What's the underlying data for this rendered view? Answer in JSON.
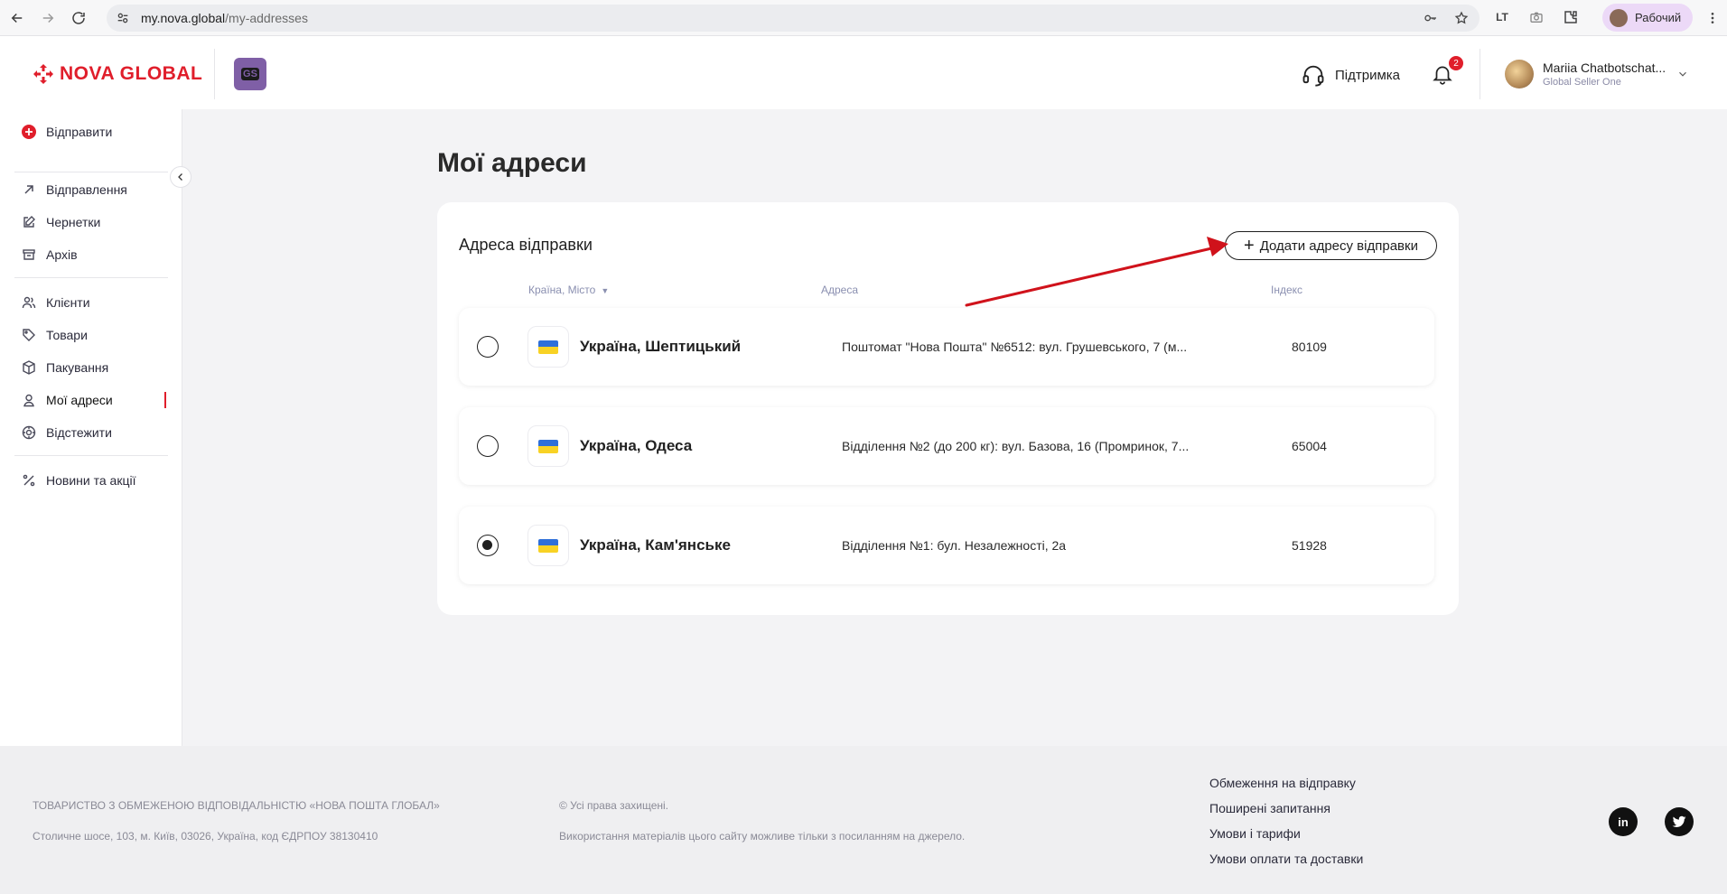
{
  "browser": {
    "url_host": "my.nova.global",
    "url_path": "/my-addresses",
    "profile_label": "Рабочий"
  },
  "header": {
    "logo_text": "NOVA GLOBAL",
    "gs_badge": "GS",
    "support_label": "Підтримка",
    "notifications_count": "2",
    "user_name": "Mariia Chatbotschat...",
    "user_org": "Global Seller One"
  },
  "sidebar": {
    "send_label": "Відправити",
    "items": [
      {
        "label": "Відправлення",
        "icon": "arrow-up-right-icon"
      },
      {
        "label": "Чернетки",
        "icon": "edit-icon"
      },
      {
        "label": "Архів",
        "icon": "archive-icon"
      },
      {
        "label": "Клієнти",
        "icon": "users-icon"
      },
      {
        "label": "Товари",
        "icon": "tag-icon"
      },
      {
        "label": "Пакування",
        "icon": "box-icon"
      },
      {
        "label": "Мої адреси",
        "icon": "location-user-icon",
        "active": true
      },
      {
        "label": "Відстежити",
        "icon": "target-icon"
      },
      {
        "label": "Новини та акції",
        "icon": "percent-icon"
      }
    ]
  },
  "main": {
    "page_title": "Мої адреси",
    "card_title": "Адреса відправки",
    "add_button_label": "Додати адресу відправки",
    "columns": {
      "country_city": "Країна, Місто",
      "address": "Адреса",
      "index": "Індекс"
    },
    "rows": [
      {
        "city": "Україна, Шептицький",
        "address": "Поштомат \"Нова Пошта\" №6512: вул. Грушевського, 7 (м...",
        "zip": "80109",
        "selected": false
      },
      {
        "city": "Україна, Одеса",
        "address": "Відділення №2 (до 200 кг): вул. Базова, 16 (Промринок, 7...",
        "zip": "65004",
        "selected": false
      },
      {
        "city": "Україна, Кам'янське",
        "address": "Відділення №1: бул. Незалежності, 2а",
        "zip": "51928",
        "selected": true
      }
    ]
  },
  "footer": {
    "company": "ТОВАРИСТВО З ОБМЕЖЕНОЮ ВІДПОВІДАЛЬНІСТЮ «НОВА ПОШТА ГЛОБАЛ»",
    "address": "Столичне шосе, 103, м. Київ, 03026, Україна, код ЄДРПОУ 38130410",
    "rights": "© Усі права захищені.",
    "usage": "Використання матеріалів цього сайту можливе тільки з посиланням на джерело.",
    "links": [
      "Обмеження на відправку",
      "Поширені запитання",
      "Умови і тарифи",
      "Умови оплати та доставки"
    ],
    "linkedin": "in",
    "twitter": "twitter"
  },
  "colors": {
    "brand_red": "#e01e2b",
    "gs_purple": "#7f5fa6",
    "annotation_arrow": "#d0121b"
  }
}
